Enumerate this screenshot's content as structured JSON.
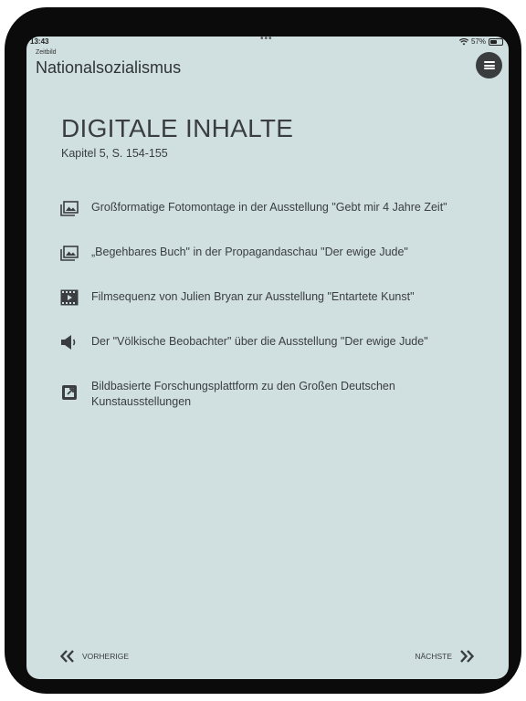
{
  "status": {
    "time": "13:43",
    "dots": "•••",
    "battery": "57%",
    "battery_level": 0.57
  },
  "header": {
    "subtitle": "Zeitbild",
    "title": "Nationalsozialismus",
    "menu_icon": "hamburger-icon"
  },
  "content": {
    "heading": "DIGITALE INHALTE",
    "chapter": "Kapitel 5, S. 154-155",
    "items": [
      {
        "icon": "image-gallery-icon",
        "label": "Großformatige Fotomontage in der Ausstellung \"Gebt mir 4 Jahre Zeit\""
      },
      {
        "icon": "image-gallery-icon",
        "label": "„Begehbares Buch\" in der Propagandaschau \"Der ewige Jude\""
      },
      {
        "icon": "film-icon",
        "label": "Filmsequenz von Julien Bryan zur Ausstellung \"Entartete Kunst\""
      },
      {
        "icon": "speaker-icon",
        "label": "Der \"Völkische Beobachter\" über die Ausstellung \"Der ewige Jude\""
      },
      {
        "icon": "external-link-icon",
        "label": "Bildbasierte Forschungsplattform zu den Großen Deutschen Kunstausstellungen"
      }
    ]
  },
  "navigation": {
    "prev_label": "VORHERIGE",
    "next_label": "NÄCHSTE"
  }
}
